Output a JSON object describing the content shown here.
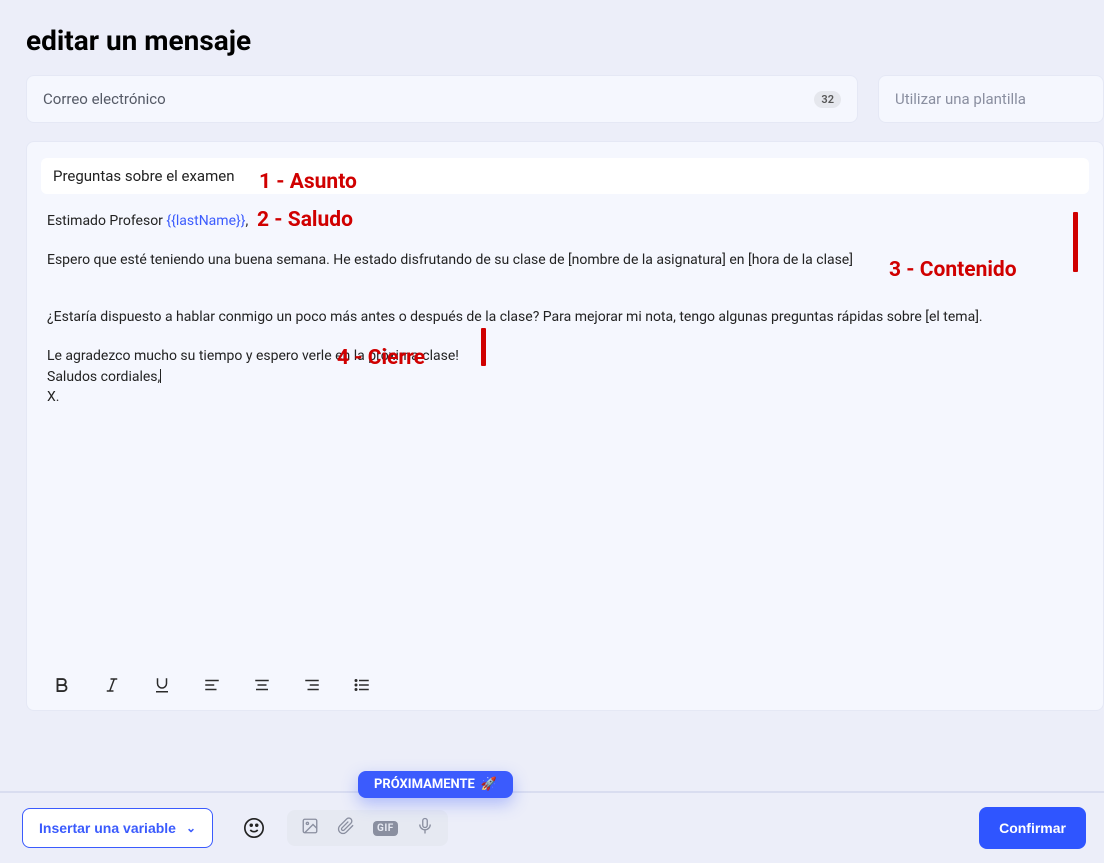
{
  "page_title": "editar un mensaje",
  "channel": {
    "label": "Correo electrónico",
    "badge": "32"
  },
  "template_placeholder": "Utilizar una plantilla",
  "subject": "Preguntas sobre el examen",
  "greeting": {
    "prefix": "Estimado Profesor ",
    "variable": "{{lastName}}",
    "suffix": ","
  },
  "body": {
    "line1": "Espero que esté teniendo una buena semana. He estado disfrutando de su clase de [nombre de la asignatura] en [hora de la clase]",
    "line2": "¿Estaría dispuesto a hablar conmigo un poco más antes o después de la clase? Para mejorar mi nota, tengo algunas preguntas rápidas sobre [el tema].",
    "closing1": "Le agradezco mucho su tiempo y espero verle en la próxima clase!",
    "closing2": "Saludos cordiales,",
    "closing3": "X."
  },
  "annotations": {
    "a1": "1 - Asunto",
    "a2": "2 - Saludo",
    "a3": "3 - Contenido",
    "a4": "4 - Cierre"
  },
  "toolbar_icons": {
    "bold": "bold-icon",
    "italic": "italic-icon",
    "underline": "underline-icon",
    "align_left": "align-left-icon",
    "align_center": "align-center-icon",
    "align_right": "align-right-icon",
    "list": "list-icon"
  },
  "footer": {
    "insert_variable": "Insertar una variable",
    "coming_soon": "PRÓXIMAMENTE",
    "coming_soon_emoji": "🚀",
    "confirm": "Confirmar",
    "gif_label": "GIF"
  }
}
